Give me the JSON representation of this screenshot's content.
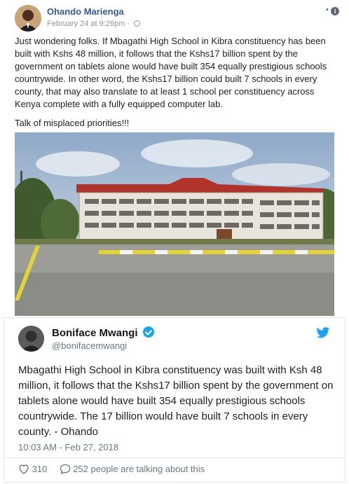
{
  "facebook_post": {
    "author": "Ohando Marienga",
    "date": "February 24 at 9:26pm",
    "date_separator": "·",
    "paragraphs": [
      "Just wondering folks. If Mbagathi High School in Kibra constituency has been built with Kshs 48 million, it follows that the Kshs17 billion spent by the government on tablets alone would have built 354 equally prestigious schools countrywide. In other word, the Kshs17 billion could built 7 schools in every county, that may also translate to at least 1 school per constituency across Kenya complete with a fully equipped computer lab.",
      "Talk of misplaced priorities!!!"
    ],
    "options_icon": "info-icon",
    "photo_icon": "school-building-photo"
  },
  "tweet": {
    "name": "Boniface Mwangi",
    "handle": "@bonifacemwangi",
    "text": "Mbagathi High School in Kibra constituency was built with Ksh 48 million, it follows that the Kshs17 billion spent by the government on tablets alone would have built 354 equally prestigious schools countrywide. The 17 billion would have built 7 schools in every county. - Ohando",
    "timestamp": "10:03 AM - Feb 27, 2018",
    "likes": "310",
    "replies_text": "252 people are talking about this",
    "brand_color": "#1da1f2"
  }
}
